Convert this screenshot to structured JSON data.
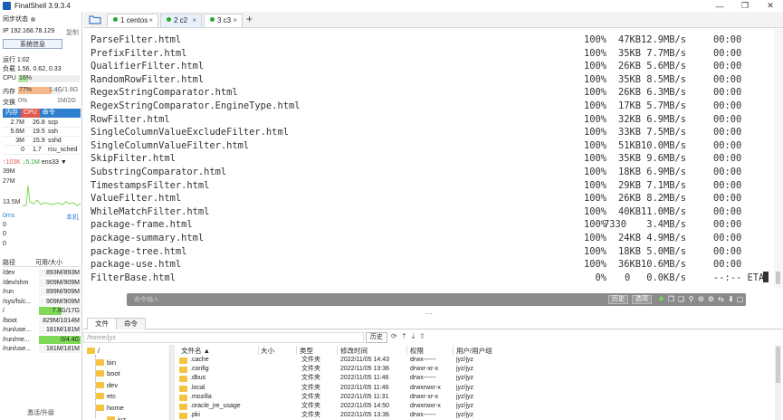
{
  "window": {
    "title": "FinalShell 3.9.3.4"
  },
  "left_panel": {
    "sync_status": "同步状态",
    "ip": "IP 192.168.78.129",
    "copy": "复制",
    "sysinfo_button": "系统信息",
    "uptime": "运行 1:02",
    "load": "负载 1.56, 0.62, 0.33",
    "cpu": {
      "label": "CPU",
      "value": "16%",
      "fraction": 0.16
    },
    "mem": {
      "label": "内存",
      "value": "77%",
      "detail": "1.4G/1.8G",
      "fraction": 0.77
    },
    "swap": {
      "label": "交换",
      "value": "0%",
      "detail": "1M/2G",
      "fraction": 0.0
    },
    "proc_tabs": [
      "内存",
      "CPU",
      "命令"
    ],
    "processes": [
      {
        "mem": "2.7M",
        "cpu": "26.8",
        "cmd": "scp"
      },
      {
        "mem": "5.6M",
        "cpu": "19.5",
        "cmd": "ssh"
      },
      {
        "mem": "3M",
        "cpu": "15.9",
        "cmd": "sshd"
      },
      {
        "mem": "0",
        "cpu": "1.7",
        "cmd": "rcu_sched"
      }
    ],
    "network": {
      "up": "↑103K",
      "down": "↓5.1M",
      "iface": "ens33",
      "scale": [
        "39M",
        "27M",
        "13.5M"
      ]
    },
    "latency": {
      "title": "0ms",
      "local": "本机",
      "values": [
        "0",
        "0",
        "0"
      ]
    },
    "disk_headers": [
      "路径",
      "可用/大小"
    ],
    "disks": [
      {
        "path": "/dev",
        "size": "893M/893M",
        "fraction": 0.0
      },
      {
        "path": "/dev/shm",
        "size": "909M/909M",
        "fraction": 0.0
      },
      {
        "path": "/run",
        "size": "899M/909M",
        "fraction": 0.0
      },
      {
        "path": "/sys/fs/c...",
        "size": "909M/909M",
        "fraction": 0.0
      },
      {
        "path": "/",
        "size": "7.9G/17G",
        "fraction": 0.55
      },
      {
        "path": "/boot",
        "size": "829M/1014M",
        "fraction": 0.0
      },
      {
        "path": "/run/use...",
        "size": "181M/181M",
        "fraction": 0.0
      },
      {
        "path": "/run/me...",
        "size": "0/4.4G",
        "fraction": 1.0
      },
      {
        "path": "/run/use...",
        "size": "181M/181M",
        "fraction": 0.0
      }
    ],
    "upgrade": "激活/升级"
  },
  "tabs": [
    {
      "label": "1 centos",
      "close": "×"
    },
    {
      "label": "2 c2",
      "close": "×"
    },
    {
      "label": "3 c3",
      "close": "×"
    }
  ],
  "add_tab": "+",
  "terminal_lines": [
    {
      "name": "ParseFilter.html",
      "pct": "100%",
      "size": "47KB",
      "rate": "12.9MB/s",
      "time": "00:00"
    },
    {
      "name": "PrefixFilter.html",
      "pct": "100%",
      "size": "35KB",
      "rate": "7.7MB/s",
      "time": "00:00"
    },
    {
      "name": "QualifierFilter.html",
      "pct": "100%",
      "size": "26KB",
      "rate": "5.6MB/s",
      "time": "00:00"
    },
    {
      "name": "RandomRowFilter.html",
      "pct": "100%",
      "size": "35KB",
      "rate": "8.5MB/s",
      "time": "00:00"
    },
    {
      "name": "RegexStringComparator.html",
      "pct": "100%",
      "size": "26KB",
      "rate": "6.3MB/s",
      "time": "00:00"
    },
    {
      "name": "RegexStringComparator.EngineType.html",
      "pct": "100%",
      "size": "17KB",
      "rate": "5.7MB/s",
      "time": "00:00"
    },
    {
      "name": "RowFilter.html",
      "pct": "100%",
      "size": "32KB",
      "rate": "6.9MB/s",
      "time": "00:00"
    },
    {
      "name": "SingleColumnValueExcludeFilter.html",
      "pct": "100%",
      "size": "33KB",
      "rate": "7.5MB/s",
      "time": "00:00"
    },
    {
      "name": "SingleColumnValueFilter.html",
      "pct": "100%",
      "size": "51KB",
      "rate": "10.0MB/s",
      "time": "00:00"
    },
    {
      "name": "SkipFilter.html",
      "pct": "100%",
      "size": "35KB",
      "rate": "9.6MB/s",
      "time": "00:00"
    },
    {
      "name": "SubstringComparator.html",
      "pct": "100%",
      "size": "18KB",
      "rate": "6.9MB/s",
      "time": "00:00"
    },
    {
      "name": "TimestampsFilter.html",
      "pct": "100%",
      "size": "29KB",
      "rate": "7.1MB/s",
      "time": "00:00"
    },
    {
      "name": "ValueFilter.html",
      "pct": "100%",
      "size": "26KB",
      "rate": "8.2MB/s",
      "time": "00:00"
    },
    {
      "name": "WhileMatchFilter.html",
      "pct": "100%",
      "size": "40KB",
      "rate": "11.0MB/s",
      "time": "00:00"
    },
    {
      "name": "package-frame.html",
      "pct": "100%",
      "size": "7330",
      "rate": "3.4MB/s",
      "time": "00:00"
    },
    {
      "name": "package-summary.html",
      "pct": "100%",
      "size": "24KB",
      "rate": "4.9MB/s",
      "time": "00:00"
    },
    {
      "name": "package-tree.html",
      "pct": "100%",
      "size": "18KB",
      "rate": "5.0MB/s",
      "time": "00:00"
    },
    {
      "name": "package-use.html",
      "pct": "100%",
      "size": "36KB",
      "rate": "10.6MB/s",
      "time": "00:00"
    },
    {
      "name": "FilterBase.html",
      "pct": "0%",
      "size": "0",
      "rate": "0.0KB/s",
      "time": "--:-- ETA"
    }
  ],
  "command_bar": {
    "placeholder": "命令输入",
    "history": "历史",
    "options": "选项"
  },
  "file_manager": {
    "tabs": [
      "文件",
      "命令"
    ],
    "path": "/home/jyz",
    "history_button": "历史",
    "tree": [
      {
        "label": "/",
        "level": 0
      },
      {
        "label": "bin",
        "level": 1
      },
      {
        "label": "boot",
        "level": 1
      },
      {
        "label": "dev",
        "level": 1
      },
      {
        "label": "etc",
        "level": 1
      },
      {
        "label": "home",
        "level": 1
      },
      {
        "label": "jyz",
        "level": 2
      }
    ],
    "columns": [
      "文件名 ▲",
      "大小",
      "类型",
      "修改时间",
      "权限",
      "用户/用户组"
    ],
    "files": [
      {
        "name": ".cache",
        "size": "",
        "type": "文件夹",
        "modified": "2022/11/05 14:43",
        "perm": "drwx------",
        "owner": "jyz/jyz"
      },
      {
        "name": ".config",
        "size": "",
        "type": "文件夹",
        "modified": "2022/11/05 13:36",
        "perm": "drwxr-xr-x",
        "owner": "jyz/jyz"
      },
      {
        "name": ".dbus",
        "size": "",
        "type": "文件夹",
        "modified": "2022/11/05 11:46",
        "perm": "drwx------",
        "owner": "jyz/jyz"
      },
      {
        "name": ".local",
        "size": "",
        "type": "文件夹",
        "modified": "2022/11/05 11:46",
        "perm": "drwxrwxr-x",
        "owner": "jyz/jyz"
      },
      {
        "name": ".mozilla",
        "size": "",
        "type": "文件夹",
        "modified": "2022/11/05 11:31",
        "perm": "drwxr-xr-x",
        "owner": "jyz/jyz"
      },
      {
        "name": ".oracle_jre_usage",
        "size": "",
        "type": "文件夹",
        "modified": "2022/11/05 14:50",
        "perm": "drwxrwxr-x",
        "owner": "jyz/jyz"
      },
      {
        "name": ".pki",
        "size": "",
        "type": "文件夹",
        "modified": "2022/11/05 13:36",
        "perm": "drwx------",
        "owner": "jyz/jyz"
      }
    ]
  },
  "colors": {
    "accent": "#2f7fd0",
    "connected": "#26a82b",
    "cpu_tab": "#e05a4d",
    "disk_fill": "#7ed957",
    "folder": "#f5c242"
  }
}
